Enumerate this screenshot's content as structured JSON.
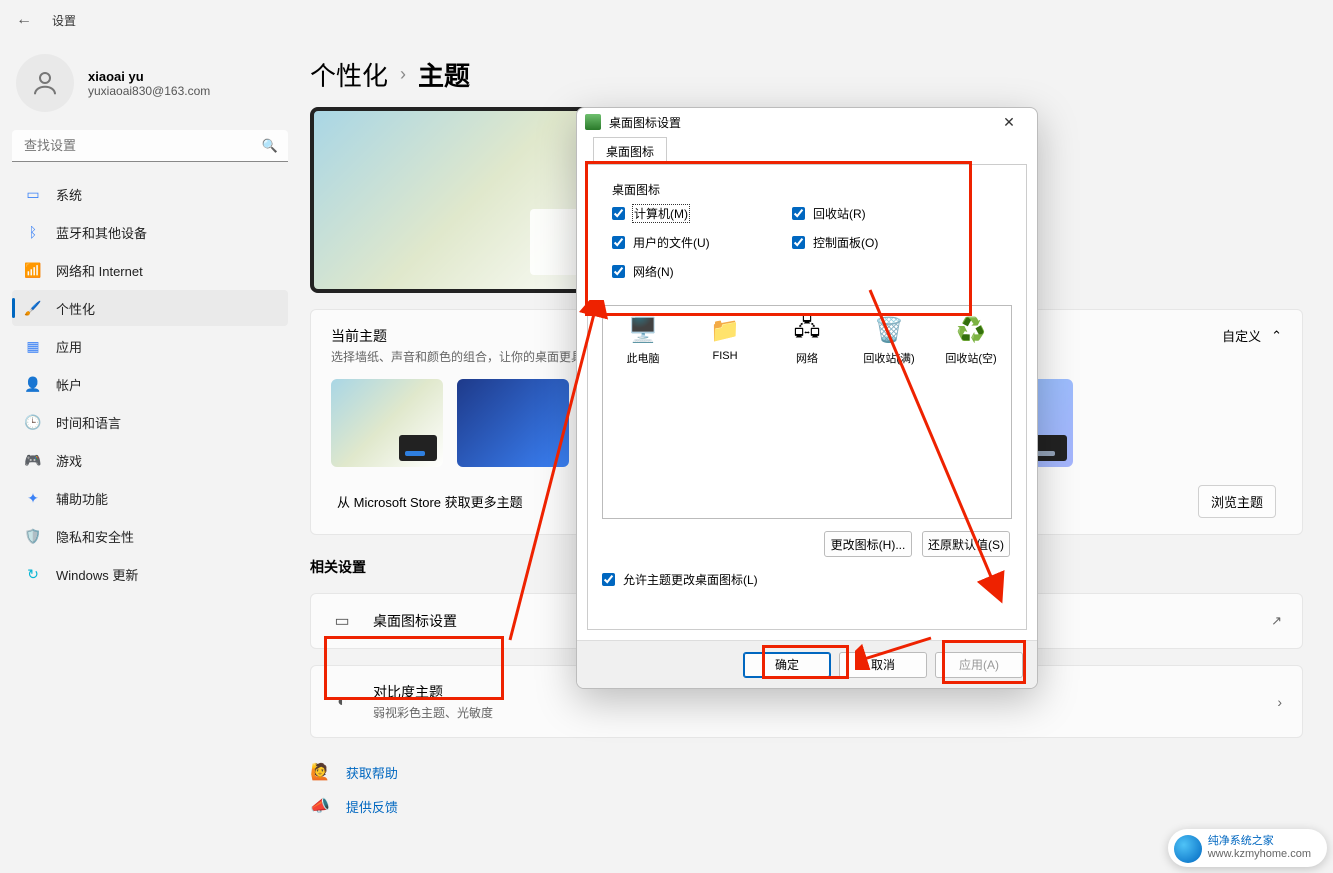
{
  "app": {
    "title": "设置"
  },
  "profile": {
    "name": "xiaoai yu",
    "email": "yuxiaoai830@163.com"
  },
  "search": {
    "placeholder": "查找设置"
  },
  "nav": [
    {
      "id": "system",
      "label": "系统",
      "icon": "🖥️",
      "color": "#3b82f6"
    },
    {
      "id": "bluetooth",
      "label": "蓝牙和其他设备",
      "icon": "●",
      "color": "#3b82f6"
    },
    {
      "id": "network",
      "label": "网络和 Internet",
      "icon": "◆",
      "color": "#06b6d4"
    },
    {
      "id": "personalization",
      "label": "个性化",
      "icon": "🖌️",
      "color": "#f59e0b",
      "selected": true
    },
    {
      "id": "apps",
      "label": "应用",
      "icon": "▦",
      "color": "#3b82f6"
    },
    {
      "id": "accounts",
      "label": "帐户",
      "icon": "👤",
      "color": "#64748b"
    },
    {
      "id": "time",
      "label": "时间和语言",
      "icon": "🌐",
      "color": "#06b6d4"
    },
    {
      "id": "gaming",
      "label": "游戏",
      "icon": "🎮",
      "color": "#94a3b8"
    },
    {
      "id": "accessibility",
      "label": "辅助功能",
      "icon": "✦",
      "color": "#3b82f6"
    },
    {
      "id": "privacy",
      "label": "隐私和安全性",
      "icon": "🛡️",
      "color": "#64748b"
    },
    {
      "id": "update",
      "label": "Windows 更新",
      "icon": "↻",
      "color": "#06b6d4"
    }
  ],
  "breadcrumb": {
    "parent": "个性化",
    "sep": "›",
    "current": "主题"
  },
  "current_theme": {
    "title": "当前主题",
    "subtitle": "选择墙纸、声音和颜色的组合，让你的桌面更具个性",
    "customize": "自定义"
  },
  "store": {
    "text": "从 Microsoft Store 获取更多主题",
    "button": "浏览主题"
  },
  "related": {
    "heading": "相关设置"
  },
  "cards": {
    "desktop_icons": {
      "title": "桌面图标设置"
    },
    "contrast": {
      "title": "对比度主题",
      "subtitle": "弱视彩色主题、光敏度"
    }
  },
  "links": {
    "help": "获取帮助",
    "feedback": "提供反馈"
  },
  "dialog": {
    "title": "桌面图标设置",
    "tab": "桌面图标",
    "group": "桌面图标",
    "checks": {
      "computer": "计算机(M)",
      "recycle": "回收站(R)",
      "userfiles": "用户的文件(U)",
      "control": "控制面板(O)",
      "network": "网络(N)"
    },
    "icons": [
      "此电脑",
      "FISH",
      "网络",
      "回收站(满)",
      "回收站(空)"
    ],
    "change_icon": "更改图标(H)...",
    "restore": "还原默认值(S)",
    "allow": "允许主题更改桌面图标(L)",
    "ok": "确定",
    "cancel": "取消",
    "apply": "应用(A)"
  },
  "watermark": {
    "l1": "纯净系统之家",
    "l2": "www.kzmyhome.com"
  }
}
